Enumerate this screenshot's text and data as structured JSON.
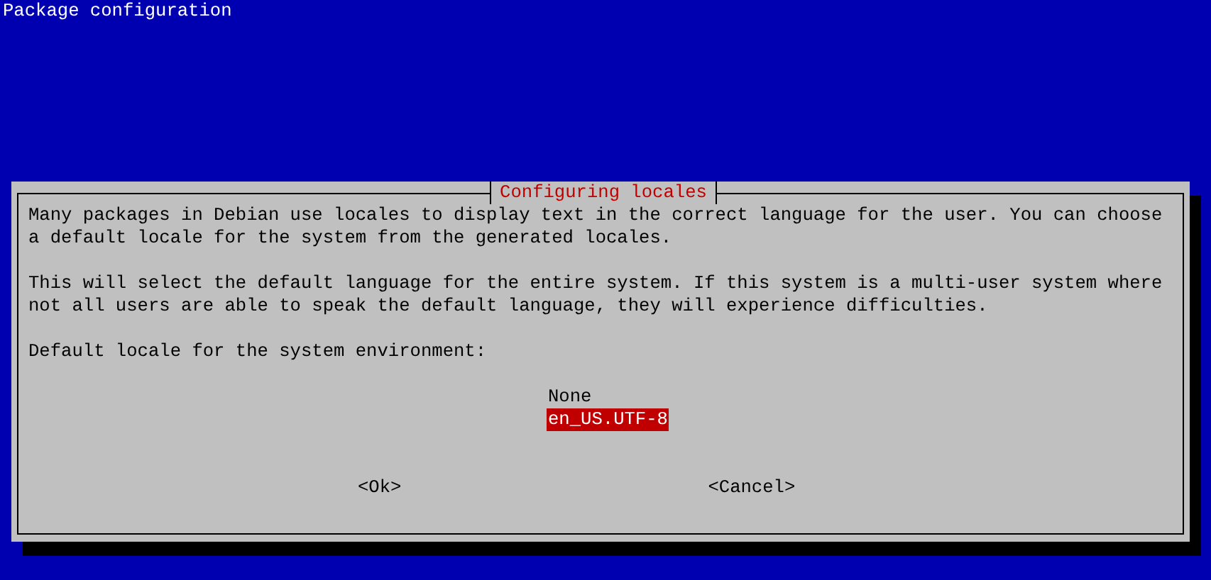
{
  "screen": {
    "title": "Package configuration"
  },
  "dialog": {
    "title": "Configuring locales",
    "paragraphs": [
      "Many packages in Debian use locales to display text in the correct language for the user. You can choose a default locale for the system from the generated locales.",
      "This will select the default language for the entire system. If this system is a multi-user system where not all users are able to speak the default language, they will experience difficulties."
    ],
    "prompt": "Default locale for the system environment:",
    "options": [
      {
        "label": "None",
        "selected": false
      },
      {
        "label": "en_US.UTF-8",
        "selected": true
      }
    ],
    "buttons": [
      {
        "label": "<Ok>",
        "selected": false
      },
      {
        "label": "<Cancel>",
        "selected": false
      }
    ]
  }
}
